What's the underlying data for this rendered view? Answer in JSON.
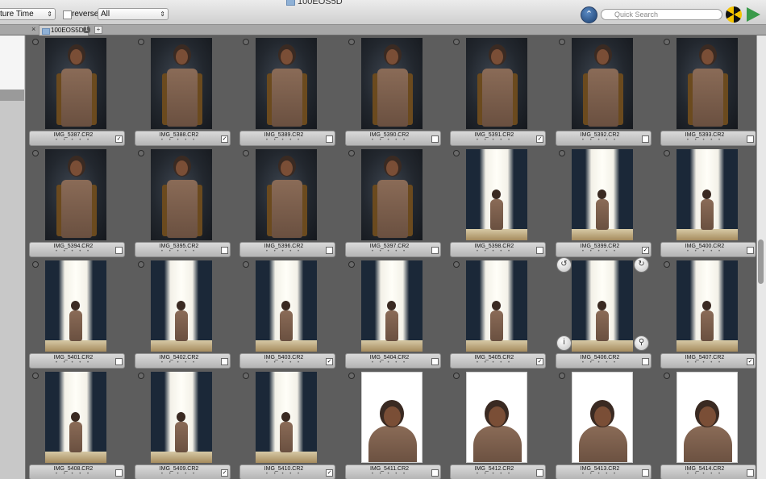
{
  "window": {
    "title": "100EOS5D"
  },
  "toolbar": {
    "sort_value": "ture Time",
    "reverse_label": "reverse",
    "filter_value": "All",
    "search_placeholder": "Quick Search"
  },
  "tabbar": {
    "tab_label": "100EOS5D",
    "tab_count": "1"
  },
  "grid": {
    "rows": [
      {
        "items": [
          {
            "name": "IMG_5387.CR2",
            "checked": true,
            "scene": "dark"
          },
          {
            "name": "IMG_5388.CR2",
            "checked": true,
            "scene": "dark"
          },
          {
            "name": "IMG_5389.CR2",
            "checked": false,
            "scene": "dark"
          },
          {
            "name": "IMG_5390.CR2",
            "checked": false,
            "scene": "dark"
          },
          {
            "name": "IMG_5391.CR2",
            "checked": true,
            "scene": "dark"
          },
          {
            "name": "IMG_5392.CR2",
            "checked": false,
            "scene": "dark"
          },
          {
            "name": "IMG_5393.CR2",
            "checked": false,
            "scene": "dark"
          }
        ]
      },
      {
        "items": [
          {
            "name": "IMG_5394.CR2",
            "checked": false,
            "scene": "dark"
          },
          {
            "name": "IMG_5395.CR2",
            "checked": false,
            "scene": "dark"
          },
          {
            "name": "IMG_5396.CR2",
            "checked": false,
            "scene": "dark"
          },
          {
            "name": "IMG_5397.CR2",
            "checked": false,
            "scene": "dark"
          },
          {
            "name": "IMG_5398.CR2",
            "checked": false,
            "scene": "window"
          },
          {
            "name": "IMG_5399.CR2",
            "checked": true,
            "scene": "window"
          },
          {
            "name": "IMG_5400.CR2",
            "checked": false,
            "scene": "window"
          }
        ]
      },
      {
        "items": [
          {
            "name": "IMG_5401.CR2",
            "checked": false,
            "scene": "window"
          },
          {
            "name": "IMG_5402.CR2",
            "checked": false,
            "scene": "window"
          },
          {
            "name": "IMG_5403.CR2",
            "checked": true,
            "scene": "window"
          },
          {
            "name": "IMG_5404.CR2",
            "checked": false,
            "scene": "window"
          },
          {
            "name": "IMG_5405.CR2",
            "checked": true,
            "scene": "window"
          },
          {
            "name": "IMG_5406.CR2",
            "checked": false,
            "scene": "window",
            "hover": true
          },
          {
            "name": "IMG_5407.CR2",
            "checked": true,
            "scene": "window"
          }
        ]
      },
      {
        "items": [
          {
            "name": "IMG_5408.CR2",
            "checked": false,
            "scene": "window"
          },
          {
            "name": "IMG_5409.CR2",
            "checked": true,
            "scene": "window"
          },
          {
            "name": "IMG_5410.CR2",
            "checked": true,
            "scene": "window"
          },
          {
            "name": "IMG_5411.CR2",
            "checked": false,
            "scene": "white"
          },
          {
            "name": "IMG_5412.CR2",
            "checked": false,
            "scene": "white"
          },
          {
            "name": "IMG_5413.CR2",
            "checked": false,
            "scene": "white"
          },
          {
            "name": "IMG_5414.CR2",
            "checked": false,
            "scene": "white"
          }
        ]
      }
    ]
  },
  "icons": {
    "nav": "navigate-up-icon",
    "search": "search-icon",
    "radiation": "radiation-icon",
    "play": "play-icon",
    "rotate_left": "rotate-left-icon",
    "rotate_right": "rotate-right-icon",
    "info": "info-icon",
    "zoom": "magnifier-icon"
  }
}
